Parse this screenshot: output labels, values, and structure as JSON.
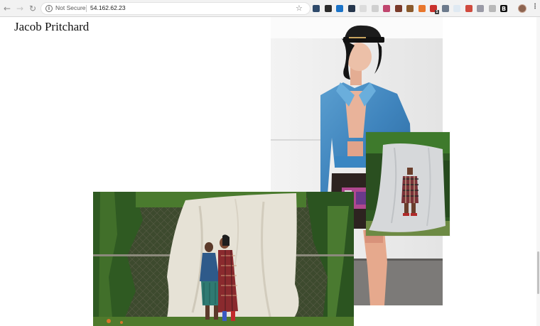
{
  "browser": {
    "security_label": "Not Secure",
    "url": "54.162.62.23",
    "icons": {
      "back": "arrow-left-icon",
      "forward": "arrow-right-icon",
      "reload": "reload-icon",
      "info": "info-icon",
      "bookmark": "star-icon",
      "menu": "kebab-menu-icon"
    },
    "extensions": [
      {
        "name": "ext-1",
        "color": "#2e4a6b"
      },
      {
        "name": "ext-2",
        "color": "#2b2b2b"
      },
      {
        "name": "ext-3",
        "color": "#1a73c8"
      },
      {
        "name": "ext-4",
        "color": "#26364d"
      },
      {
        "name": "ext-5",
        "color": "#dcdcdc"
      },
      {
        "name": "ext-6",
        "color": "#cfcfcf"
      },
      {
        "name": "ext-7",
        "color": "#c0466e"
      },
      {
        "name": "ext-8",
        "color": "#7a3a2a"
      },
      {
        "name": "ext-9",
        "color": "#8a5a2c"
      },
      {
        "name": "ext-10",
        "color": "#e8762c"
      },
      {
        "name": "ext-11",
        "color": "#c9302c",
        "badge": "1"
      },
      {
        "name": "ext-12",
        "color": "#6c7a8c"
      },
      {
        "name": "ext-13",
        "color": "#dfe9f2"
      },
      {
        "name": "ext-14",
        "color": "#d04a3e"
      },
      {
        "name": "ext-15",
        "color": "#9a9aa6"
      },
      {
        "name": "ext-16",
        "color": "#b8b8b8"
      },
      {
        "name": "ext-17",
        "color": "#111111",
        "text": "B"
      }
    ]
  },
  "page": {
    "site_title": "Jacob Pritchard",
    "photos": [
      {
        "name": "photo-model-blue-leather-jacket",
        "alt": ""
      },
      {
        "name": "photo-model-plaid-coat-backdrop",
        "alt": ""
      },
      {
        "name": "photo-two-models-drape-backdrop",
        "alt": ""
      }
    ]
  }
}
